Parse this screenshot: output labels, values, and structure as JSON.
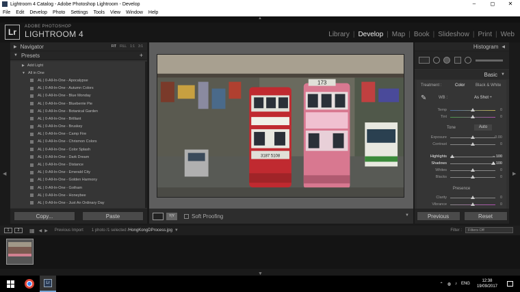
{
  "window": {
    "title": "Lightroom 4 Catalog - Adobe Photoshop Lightroom - Develop",
    "minimize": "–",
    "maximize": "◻",
    "close": "✕"
  },
  "menu": [
    "File",
    "Edit",
    "Develop",
    "Photo",
    "Settings",
    "Tools",
    "View",
    "Window",
    "Help"
  ],
  "identity": {
    "logo": "Lr",
    "line1": "ADOBE PHOTOSHOP",
    "line2": "LIGHTROOM 4"
  },
  "modules": {
    "library": "Library",
    "develop": "Develop",
    "map": "Map",
    "book": "Book",
    "slideshow": "Slideshow",
    "print": "Print",
    "web": "Web",
    "sep": "|"
  },
  "navigator": {
    "label": "Navigator",
    "fit": "FIT",
    "fill": "FILL",
    "z1": "1:1",
    "z2": "3:1"
  },
  "presets": {
    "label": "Presets",
    "add": "+",
    "groups": {
      "add_light": "Add Light",
      "all_in_one": "All in One"
    },
    "items": [
      "AL | 0-All-In-One - Apocalypse",
      "AL | 0-All-In-One - Autumn Colors",
      "AL | 0-All-In-One - Blue Monday",
      "AL | 0-All-In-One - Blueberrie Pie",
      "AL | 0-All-In-One - Botanical Garden",
      "AL | 0-All-In-One - Brilliant",
      "AL | 0-All-In-One - Bruskey",
      "AL | 0-All-In-One - Camp Fire",
      "AL | 0-All-In-One - Chrismon Colors",
      "AL | 0-All-In-One - Color Splash",
      "AL | 0-All-In-One - Dark Dream",
      "AL | 0-All-In-One - Distance",
      "AL | 0-All-In-One - Emerald City",
      "AL | 0-All-In-One - Golden Harmony",
      "AL | 0-All-In-One - Gotham",
      "AL | 0-All-In-One - Honeybee",
      "AL | 0-All-In-One - Just An Ordinary Day"
    ]
  },
  "left_buttons": {
    "copy": "Copy...",
    "paste": "Paste"
  },
  "toolbar": {
    "soft_proofing": "Soft Proofing",
    "yy": "Y|Y"
  },
  "right": {
    "histogram": "Histogram",
    "basic": "Basic",
    "treatment": "Treatment :",
    "color": "Color",
    "bw": "Black & White",
    "wb": "WB :",
    "wb_value": "As Shot ÷",
    "tone": "Tone",
    "auto": "Auto",
    "presence": "Presence"
  },
  "sliders": {
    "temp": {
      "label": "Temp",
      "value": "0",
      "pos": 0.5
    },
    "tint": {
      "label": "Tint",
      "value": "0",
      "pos": 0.5
    },
    "exposure": {
      "label": "Exposure",
      "value": "0.00",
      "pos": 0.5
    },
    "contrast": {
      "label": "Contrast",
      "value": "0",
      "pos": 0.5
    },
    "highlights": {
      "label": "Highlights",
      "value": "– 100",
      "pos": 0.05
    },
    "shadows": {
      "label": "Shadows",
      "value": "+ 100",
      "pos": 0.95
    },
    "whites": {
      "label": "Whites",
      "value": "0",
      "pos": 0.5
    },
    "blacks": {
      "label": "Blacks",
      "value": "0",
      "pos": 0.5
    },
    "clarity": {
      "label": "Clarity",
      "value": "0",
      "pos": 0.5
    },
    "vibrance": {
      "label": "Vibrance",
      "value": "0",
      "pos": 0.5
    }
  },
  "right_buttons": {
    "previous": "Previous",
    "reset": "Reset"
  },
  "filmbar": {
    "b1": "1",
    "b2": "2",
    "source": "Previous Import",
    "count": "1 photo /1 selected /",
    "filename": "HongKongDProcess.jpg",
    "filter_label": "Filter :",
    "filter_value": "Filters Off"
  },
  "tram": {
    "left_number": "173",
    "left_plate": "3187 5108"
  },
  "taskbar": {
    "lang": "ENG",
    "time": "12:38",
    "date": "19/09/2017"
  }
}
